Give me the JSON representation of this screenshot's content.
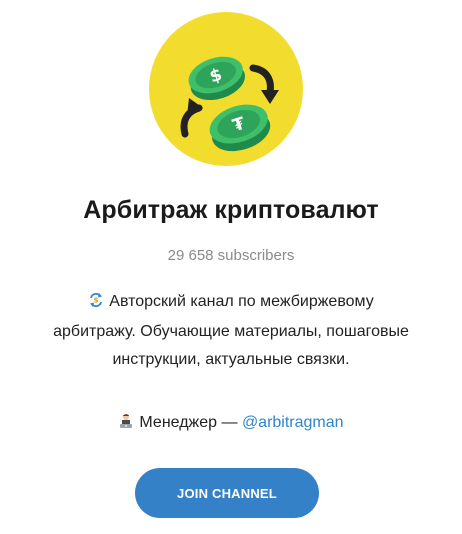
{
  "channel": {
    "title": "Арбитраж криптовалют",
    "subscribers": "29 658 subscribers",
    "avatar_icon": "crypto-exchange-arrows-icon",
    "avatar_background": "#f2dc2e"
  },
  "description": {
    "emoji_icon": "currency-exchange-icon",
    "line1": "Авторский канал по межбиржевому",
    "line2": "арбитражу. Обучающие материалы, пошаговые",
    "line3": "инструкции, актуальные связки."
  },
  "manager": {
    "emoji_icon": "man-technologist-icon",
    "label": "Менеджер — ",
    "link": "@arbitragman",
    "link_color": "#2f86c8"
  },
  "join_button": {
    "label": "JOIN CHANNEL",
    "color": "#3581c8"
  }
}
